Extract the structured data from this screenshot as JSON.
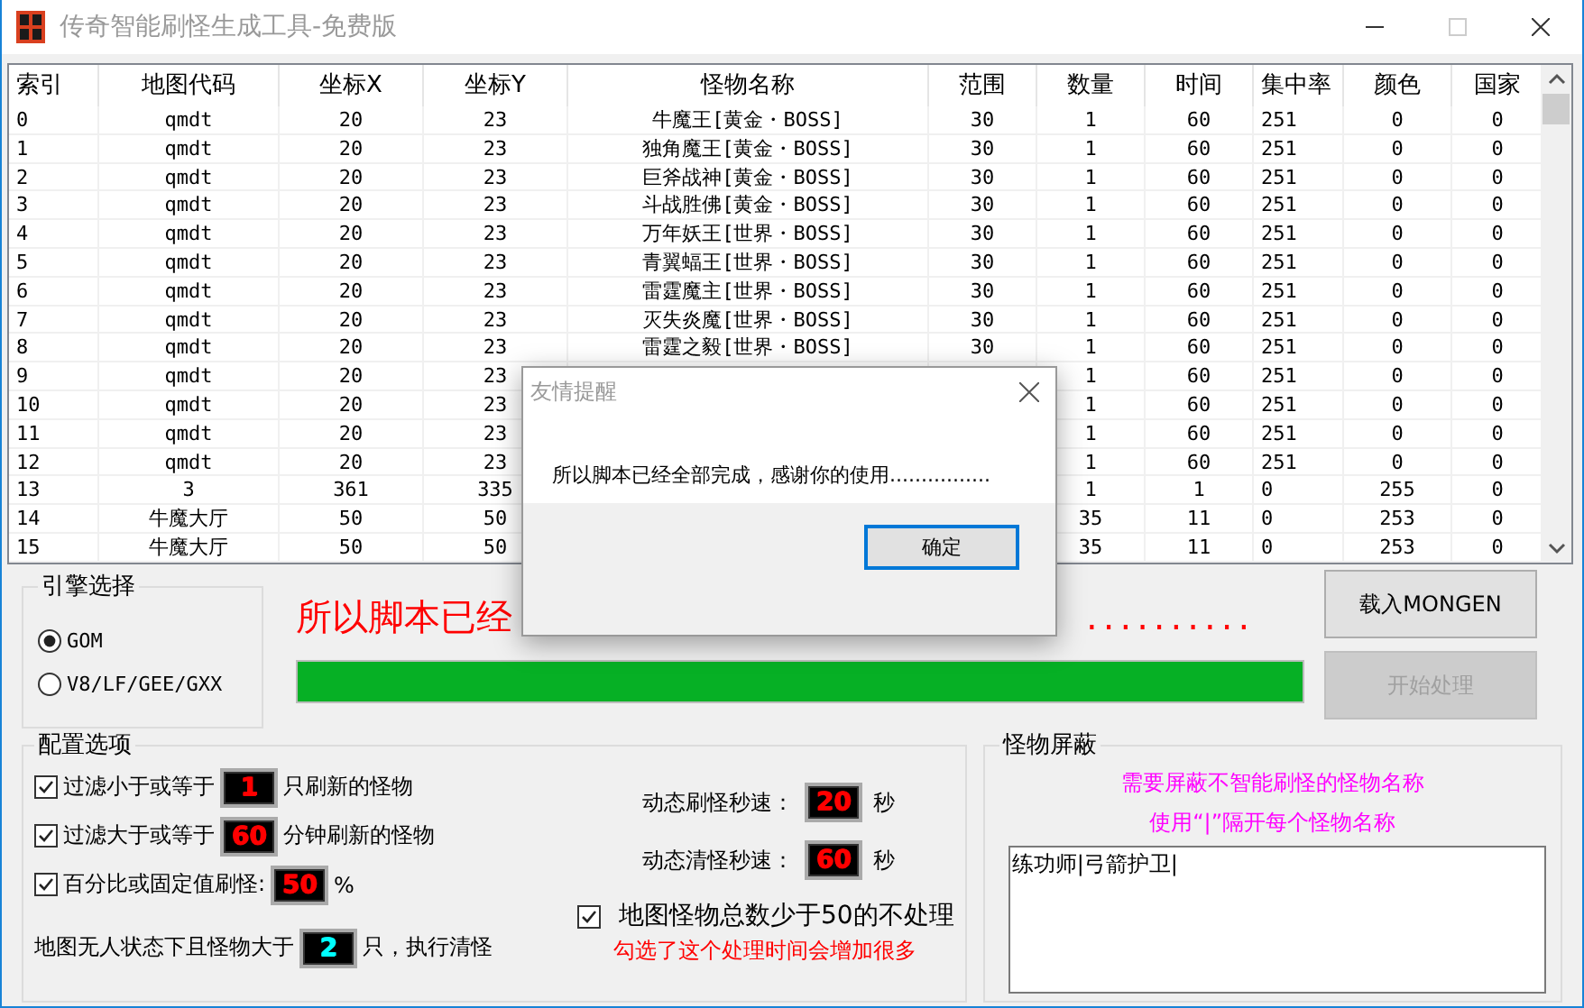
{
  "window": {
    "title": "传奇智能刷怪生成工具-免费版"
  },
  "table": {
    "columns": [
      "索引",
      "地图代码",
      "坐标X",
      "坐标Y",
      "怪物名称",
      "范围",
      "数量",
      "时间",
      "集中率",
      "颜色",
      "国家"
    ],
    "rows": [
      {
        "cells": [
          "0",
          "qmdt",
          "20",
          "23",
          "牛魔王[黄金・BOSS]",
          "30",
          "1",
          "60",
          "251",
          "0",
          "0"
        ]
      },
      {
        "cells": [
          "1",
          "qmdt",
          "20",
          "23",
          "独角魔王[黄金・BOSS]",
          "30",
          "1",
          "60",
          "251",
          "0",
          "0"
        ]
      },
      {
        "cells": [
          "2",
          "qmdt",
          "20",
          "23",
          "巨斧战神[黄金・BOSS]",
          "30",
          "1",
          "60",
          "251",
          "0",
          "0"
        ]
      },
      {
        "cells": [
          "3",
          "qmdt",
          "20",
          "23",
          "斗战胜佛[黄金・BOSS]",
          "30",
          "1",
          "60",
          "251",
          "0",
          "0"
        ]
      },
      {
        "cells": [
          "4",
          "qmdt",
          "20",
          "23",
          "万年妖王[世界・BOSS]",
          "30",
          "1",
          "60",
          "251",
          "0",
          "0"
        ]
      },
      {
        "cells": [
          "5",
          "qmdt",
          "20",
          "23",
          "青翼蝠王[世界・BOSS]",
          "30",
          "1",
          "60",
          "251",
          "0",
          "0"
        ]
      },
      {
        "cells": [
          "6",
          "qmdt",
          "20",
          "23",
          "雷霆魔主[世界・BOSS]",
          "30",
          "1",
          "60",
          "251",
          "0",
          "0"
        ]
      },
      {
        "cells": [
          "7",
          "qmdt",
          "20",
          "23",
          "灭失炎魔[世界・BOSS]",
          "30",
          "1",
          "60",
          "251",
          "0",
          "0"
        ]
      },
      {
        "cells": [
          "8",
          "qmdt",
          "20",
          "23",
          "雷霆之毅[世界・BOSS]",
          "30",
          "1",
          "60",
          "251",
          "0",
          "0"
        ]
      },
      {
        "cells": [
          "9",
          "qmdt",
          "20",
          "23",
          null,
          null,
          "1",
          "60",
          "251",
          "0",
          "0"
        ]
      },
      {
        "cells": [
          "10",
          "qmdt",
          "20",
          "23",
          null,
          null,
          "1",
          "60",
          "251",
          "0",
          "0"
        ]
      },
      {
        "cells": [
          "11",
          "qmdt",
          "20",
          "23",
          null,
          null,
          "1",
          "60",
          "251",
          "0",
          "0"
        ]
      },
      {
        "cells": [
          "12",
          "qmdt",
          "20",
          "23",
          null,
          null,
          "1",
          "60",
          "251",
          "0",
          "0"
        ]
      },
      {
        "cells": [
          "13",
          "3",
          "361",
          "335",
          null,
          null,
          "1",
          "1",
          "0",
          "255",
          "0"
        ]
      },
      {
        "cells": [
          "14",
          "牛魔大厅",
          "50",
          "50",
          null,
          null,
          "35",
          "11",
          "0",
          "253",
          "0"
        ]
      },
      {
        "cells": [
          "15",
          "牛魔大厅",
          "50",
          "50",
          null,
          null,
          "35",
          "11",
          "0",
          "253",
          "0"
        ]
      }
    ]
  },
  "engine": {
    "title": "引擎选择",
    "options": [
      {
        "label": "GOM",
        "selected": true
      },
      {
        "label": "V8/LF/GEE/GXX",
        "selected": false
      }
    ]
  },
  "status": {
    "text_start": "所以脚本已经",
    "text_end": ".........."
  },
  "progress": {
    "level": 1.0
  },
  "buttons": [
    {
      "label": "载入MONGEN",
      "disabled": false
    },
    {
      "label": "开始处理",
      "disabled": true
    }
  ],
  "config": {
    "title": "配置选项",
    "options": [
      {
        "kind": "checkbox",
        "checked": true,
        "label": "过滤小于或等于",
        "value": "1",
        "color": "#ff0000",
        "suffix": "只刷新的怪物"
      },
      {
        "kind": "checkbox",
        "checked": true,
        "label": "过滤大于或等于",
        "value": "60",
        "color": "#ff0000",
        "suffix": "分钟刷新的怪物"
      },
      {
        "kind": "checkbox",
        "checked": true,
        "label": "百分比或固定值刷怪:",
        "value": "50",
        "color": "#ff0000",
        "suffix": "%"
      },
      {
        "kind": "plain",
        "label": "地图无人状态下且怪物大于",
        "value": "2",
        "color": "#00ffff",
        "suffix": "只，执行清怪"
      }
    ],
    "speeds": [
      {
        "label": "动态刷怪秒速：",
        "value": "20",
        "suffix": "秒"
      },
      {
        "label": "动态清怪秒速：",
        "value": "60",
        "suffix": "秒"
      }
    ],
    "skip_small": {
      "checked": true,
      "label": "地图怪物总数少于50的不处理",
      "note": "勾选了这个处理时间会增加很多"
    }
  },
  "block": {
    "title": "怪物屏蔽",
    "hints": [
      "需要屏蔽不智能刷怪的怪物名称",
      "使用“|”隔开每个怪物名称"
    ],
    "value": "练功师|弓箭护卫|"
  },
  "dialog": {
    "title": "友情提醒",
    "message": "所以脚本已经全部完成，感谢你的使用................",
    "button": "确定"
  }
}
